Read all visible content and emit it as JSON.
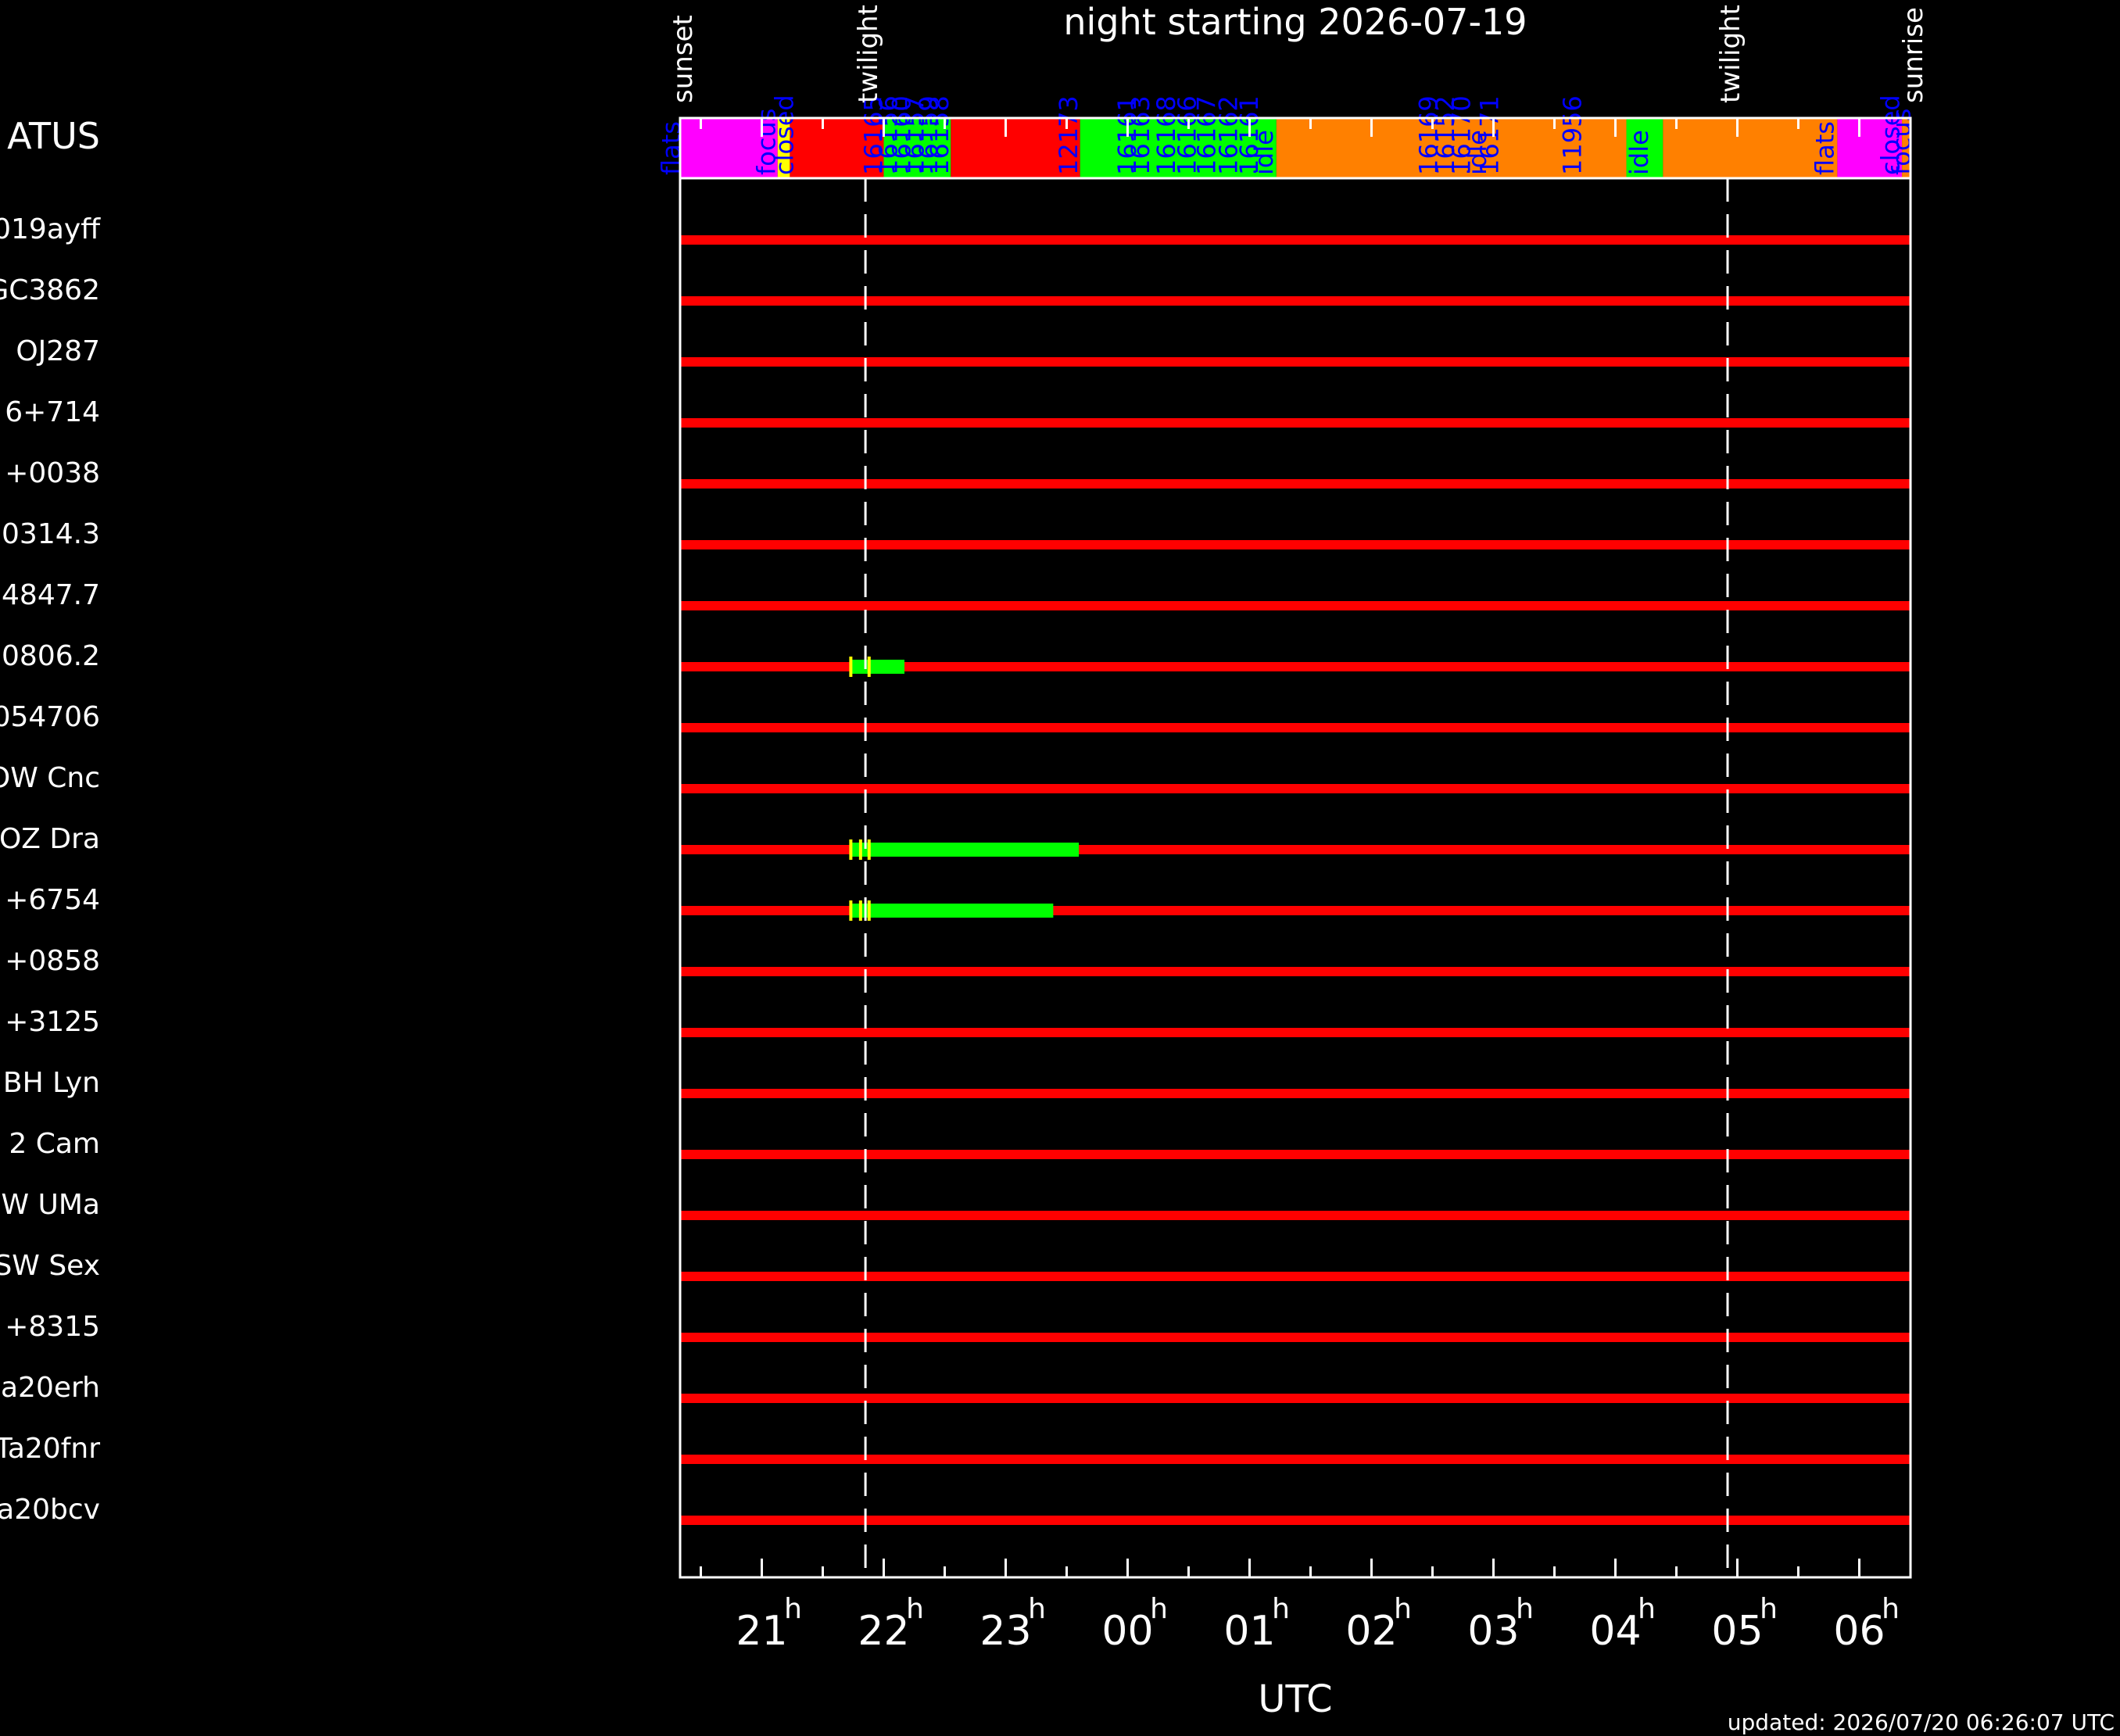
{
  "chart_data": {
    "type": "timeline",
    "title": "night starting 2026-07-19",
    "xlabel": "UTC",
    "updated": "updated: 2026/07/20 06:26:07 UTC",
    "x_range_hours": [
      20.33,
      30.42
    ],
    "ticks": [
      {
        "hour": 21,
        "label": "21",
        "sup": "h"
      },
      {
        "hour": 22,
        "label": "22",
        "sup": "h"
      },
      {
        "hour": 23,
        "label": "23",
        "sup": "h"
      },
      {
        "hour": 24,
        "label": "00",
        "sup": "h"
      },
      {
        "hour": 25,
        "label": "01",
        "sup": "h"
      },
      {
        "hour": 26,
        "label": "02",
        "sup": "h"
      },
      {
        "hour": 27,
        "label": "03",
        "sup": "h"
      },
      {
        "hour": 28,
        "label": "04",
        "sup": "h"
      },
      {
        "hour": 29,
        "label": "05",
        "sup": "h"
      },
      {
        "hour": 30,
        "label": "06",
        "sup": "h"
      }
    ],
    "events": [
      {
        "label": "sunset",
        "hour": 20.33,
        "dashed": false
      },
      {
        "label": "twilight",
        "hour": 21.85,
        "dashed": true
      },
      {
        "label": "twilight",
        "hour": 28.92,
        "dashed": true
      },
      {
        "label": "sunrise",
        "hour": 30.42,
        "dashed": false
      }
    ],
    "status_label": "ATUS",
    "status_segments": [
      {
        "start": 20.33,
        "end": 21.13,
        "status": "flats",
        "color": "#ff00ff"
      },
      {
        "start": 21.13,
        "end": 21.23,
        "status": "focus",
        "color": "#ffff00"
      },
      {
        "start": 21.23,
        "end": 22.0,
        "status": "closed",
        "color": "#ff0000"
      },
      {
        "start": 22.0,
        "end": 22.55,
        "status": "observing",
        "color": "#00ff00"
      },
      {
        "start": 22.55,
        "end": 23.61,
        "status": "closed",
        "color": "#ff0000"
      },
      {
        "start": 23.61,
        "end": 25.22,
        "status": "observing",
        "color": "#00ff00"
      },
      {
        "start": 25.22,
        "end": 27.0,
        "status": "weather",
        "color": "#ff8000"
      },
      {
        "start": 27.0,
        "end": 28.09,
        "status": "weather",
        "color": "#ff8000"
      },
      {
        "start": 28.09,
        "end": 28.39,
        "status": "observing",
        "color": "#00ff00"
      },
      {
        "start": 28.39,
        "end": 29.82,
        "status": "weather",
        "color": "#ff8000"
      },
      {
        "start": 29.82,
        "end": 30.35,
        "status": "flats",
        "color": "#ff00ff"
      },
      {
        "start": 30.35,
        "end": 30.42,
        "status": "closed",
        "color": "#ff8000"
      }
    ],
    "status_annotations": [
      {
        "hour": 20.27,
        "text": "flats",
        "color": "#0000ff"
      },
      {
        "hour": 21.05,
        "text": "focus",
        "color": "#0000ff"
      },
      {
        "hour": 21.2,
        "text": "closed",
        "color": "#0000ff"
      },
      {
        "hour": 21.93,
        "text": "16165",
        "color": "#0000ff"
      },
      {
        "hour": 22.05,
        "text": "16156",
        "color": "#0000ff"
      },
      {
        "hour": 22.16,
        "text": "16160",
        "color": "#0000ff"
      },
      {
        "hour": 22.27,
        "text": "16157",
        "color": "#0000ff"
      },
      {
        "hour": 22.38,
        "text": "16159",
        "color": "#0000ff"
      },
      {
        "hour": 22.47,
        "text": "16158",
        "color": "#0000ff"
      },
      {
        "hour": 23.53,
        "text": "12173",
        "color": "#0000ff"
      },
      {
        "hour": 24.01,
        "text": "16161",
        "color": "#0000ff"
      },
      {
        "hour": 24.12,
        "text": "16163",
        "color": "#0000ff"
      },
      {
        "hour": 24.33,
        "text": "16168",
        "color": "#0000ff"
      },
      {
        "hour": 24.5,
        "text": "16166",
        "color": "#0000ff"
      },
      {
        "hour": 24.66,
        "text": "16167",
        "color": "#0000ff"
      },
      {
        "hour": 24.84,
        "text": "16162",
        "color": "#0000ff"
      },
      {
        "hour": 25.01,
        "text": "16161",
        "color": "#0000ff"
      },
      {
        "hour": 25.13,
        "text": "idle",
        "color": "#0000ff"
      },
      {
        "hour": 26.48,
        "text": "16169",
        "color": "#0000ff"
      },
      {
        "hour": 26.62,
        "text": "16152",
        "color": "#0000ff"
      },
      {
        "hour": 26.75,
        "text": "16170",
        "color": "#0000ff"
      },
      {
        "hour": 26.88,
        "text": "idle",
        "color": "#0000ff"
      },
      {
        "hour": 26.98,
        "text": "16171",
        "color": "#0000ff"
      },
      {
        "hour": 27.66,
        "text": "11956",
        "color": "#0000ff"
      },
      {
        "hour": 28.21,
        "text": "idle",
        "color": "#0000ff"
      },
      {
        "hour": 29.73,
        "text": "flats",
        "color": "#0000ff"
      },
      {
        "hour": 30.27,
        "text": "closed",
        "color": "#0000ff"
      },
      {
        "hour": 30.36,
        "text": "focus",
        "color": "#0000ff"
      }
    ],
    "targets": [
      {
        "name": "019ayff",
        "observed": []
      },
      {
        "name": "GC3862",
        "observed": []
      },
      {
        "name": "OJ287",
        "observed": []
      },
      {
        "name": "6+714",
        "observed": []
      },
      {
        "name": "+0038",
        "observed": []
      },
      {
        "name": "0314.3",
        "observed": []
      },
      {
        "name": "4847.7",
        "observed": []
      },
      {
        "name": "0806.2",
        "observed": [
          [
            21.73,
            22.17
          ]
        ],
        "marks": [
          21.73,
          21.88
        ]
      },
      {
        "name": "054706",
        "observed": []
      },
      {
        "name": "OW Cnc",
        "observed": []
      },
      {
        "name": "OZ Dra",
        "observed": [
          [
            21.73,
            23.6
          ]
        ],
        "marks": [
          21.73,
          21.81,
          21.88
        ]
      },
      {
        "name": "+6754",
        "observed": [
          [
            21.73,
            23.39
          ]
        ],
        "marks": [
          21.73,
          21.81,
          21.88
        ]
      },
      {
        "name": "+0858",
        "observed": []
      },
      {
        "name": "+3125",
        "observed": []
      },
      {
        "name": "BH Lyn",
        "observed": []
      },
      {
        "name": "2 Cam",
        "observed": []
      },
      {
        "name": "W UMa",
        "observed": []
      },
      {
        "name": "SW Sex",
        "observed": []
      },
      {
        "name": "+8315",
        "observed": []
      },
      {
        "name": "a20erh",
        "observed": []
      },
      {
        "name": "Ta20fnr",
        "observed": []
      },
      {
        "name": "a20bcv",
        "observed": []
      }
    ],
    "colors": {
      "background": "#000000",
      "frame": "#ffffff",
      "unavailable": "#ff0000",
      "observed": "#00ff00",
      "mark": "#ffff00",
      "annotation": "#0000ff"
    }
  }
}
